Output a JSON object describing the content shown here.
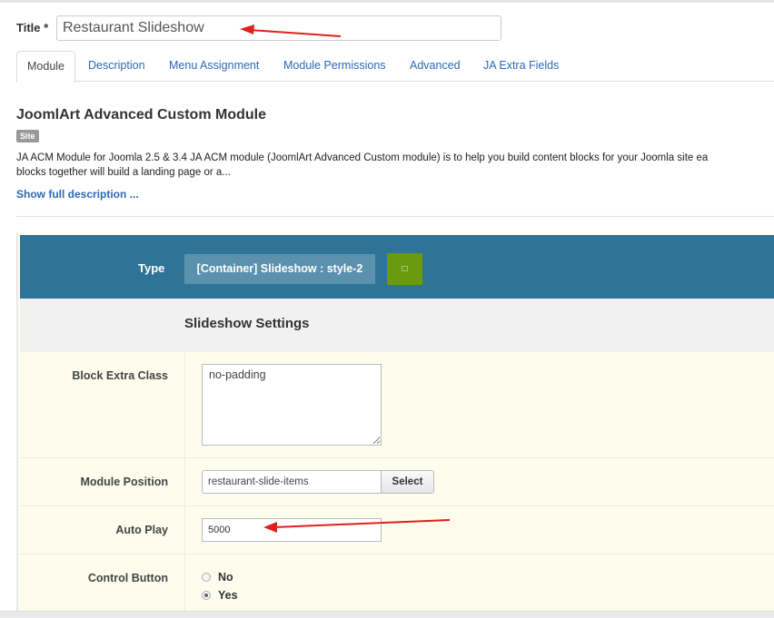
{
  "title_field": {
    "label": "Title *",
    "value": "Restaurant Slideshow"
  },
  "tabs": [
    {
      "label": "Module",
      "active": true
    },
    {
      "label": "Description"
    },
    {
      "label": "Menu Assignment"
    },
    {
      "label": "Module Permissions"
    },
    {
      "label": "Advanced"
    },
    {
      "label": "JA Extra Fields"
    }
  ],
  "module": {
    "title": "JoomlArt Advanced Custom Module",
    "badge": "Site",
    "desc_line1": "JA ACM Module for Joomla 2.5 & 3.4 JA ACM module (JoomlArt Advanced Custom module) is to help you build content blocks for your Joomla site ea",
    "desc_line2": "blocks together will build a landing page or a...",
    "show_full": "Show full description ..."
  },
  "acm": {
    "type_label": "Type",
    "type_value": "[Container] Slideshow : style-2",
    "settings_title": "Slideshow Settings",
    "fields": {
      "block_extra_class": {
        "label": "Block Extra Class",
        "value": "no-padding"
      },
      "module_position": {
        "label": "Module Position",
        "value": "restaurant-slide-items",
        "button": "Select"
      },
      "auto_play": {
        "label": "Auto Play",
        "value": "5000"
      },
      "control_button": {
        "label": "Control Button",
        "options": [
          "No",
          "Yes"
        ],
        "selected": "Yes"
      }
    }
  },
  "colors": {
    "type_bar": "#2f7498",
    "type_button": "#6a9a10",
    "panel_bg": "#fdfdee",
    "link": "#2a69b8",
    "annotation_arrow": "#e0201e"
  },
  "icons": {
    "type_button_icon": "square-glyph"
  }
}
